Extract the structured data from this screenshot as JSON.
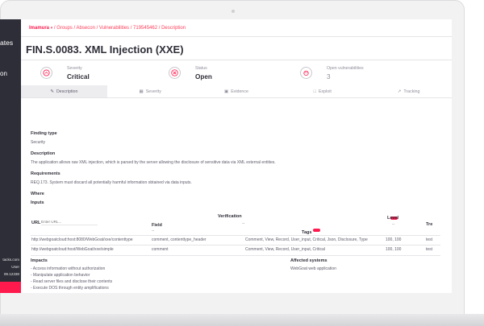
{
  "sidebar": {
    "title_line1": "ates",
    "title_line2": "",
    "subtitle": "on",
    "footer_domain": "tacks.com",
    "footer_role": "User",
    "footer_build": "09.12338"
  },
  "breadcrumb": {
    "user": "Imamura",
    "path": "/ Groups / Absecon / Vulnerabilities / 719545462 / Description"
  },
  "finding": {
    "title": "FIN.S.0083. XML Injection (XXE)"
  },
  "indicators": [
    {
      "label": "Severity",
      "value": "Critical",
      "icon": "severity-gauge-icon"
    },
    {
      "label": "Status",
      "value": "Open",
      "icon": "open-status-icon"
    },
    {
      "label": "Open vulnerabilities",
      "value": "3",
      "icon": "bug-icon"
    }
  ],
  "tabs": [
    {
      "label": "Description",
      "icon": "edit-icon",
      "active": true
    },
    {
      "label": "Severity",
      "icon": "calculator-icon",
      "active": false
    },
    {
      "label": "Evidence",
      "icon": "image-icon",
      "active": false
    },
    {
      "label": "Exploit",
      "icon": "document-icon",
      "active": false
    },
    {
      "label": "Tracking",
      "icon": "chart-line-icon",
      "active": false
    }
  ],
  "description": {
    "finding_type_label": "Finding type",
    "finding_type_value": "Security",
    "description_label": "Description",
    "description_text": "The application allows raw XML injection, which is parsed by the server allowing the disclosure of sensitive data via XML external entities.",
    "requirements_label": "Requirements",
    "requirements_text": "REQ.173. System must discard all potentially harmful information obtained via data inputs.",
    "where_label": "Where",
    "inputs_label": "Inputs"
  },
  "inputs_table": {
    "verification_header": "Verification",
    "level_header": "Level",
    "url_header": "URL",
    "url_placeholder": "Enter URL...",
    "field_header": "Field",
    "tags_header": "Tags",
    "tags_badge": "",
    "tre_header": "Tre",
    "dash": "--",
    "rows": [
      {
        "url": "http://webgoatcloud:host:8080/WebGoat/xxe/contenttype",
        "field": "comment, contenttype_header",
        "tags": "Comment, View, Record, User_input, Critical, Json, Disclosure, Type",
        "level": "100, 100",
        "tre": "test"
      },
      {
        "url": "http://webgoatcloud:host/WebGoat/xxe/simple",
        "field": "comment",
        "tags": "Comment, View, Record, User_input, Critical",
        "level": "100, 100",
        "tre": "test"
      }
    ]
  },
  "impacts": {
    "label": "Impacts",
    "items": [
      "- Access information without authorization",
      "- Manipulate application behavior",
      "- Read server files and disclose their contents",
      "- Execute DOS through entity amplifications"
    ]
  },
  "affected_systems": {
    "label": "Affected systems",
    "value": "WebGoat web application"
  },
  "colors": {
    "accent": "#ff1a4e",
    "sidebar": "#2e2e38",
    "text": "#2e2e38",
    "muted": "#8f8e9b"
  }
}
